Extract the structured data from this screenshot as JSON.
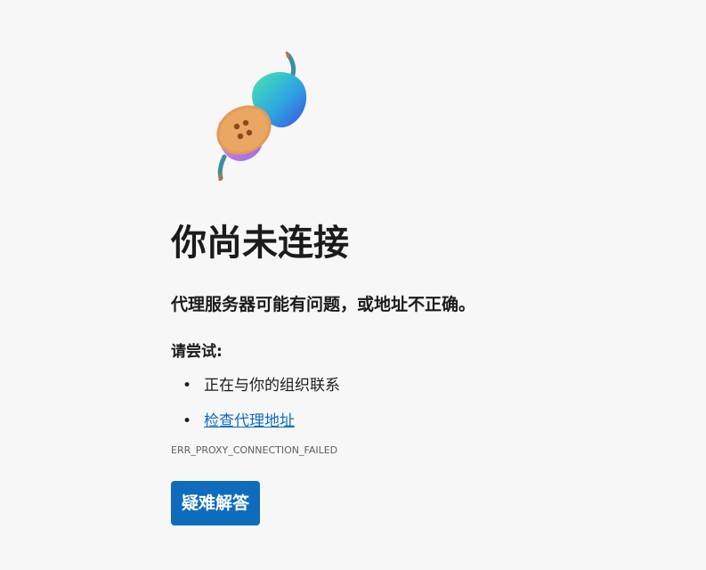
{
  "illustration": {
    "icon": "disconnected-plug-icon",
    "colors": {
      "plug_gradient_start": "#3ddcb0",
      "plug_gradient_end": "#2f5fe8",
      "socket_cookie": "#e39a55",
      "socket_purple": "#c27be8",
      "cable": "#3a8ea0",
      "cable_end": "#c2703a"
    }
  },
  "error": {
    "title": "你尚未连接",
    "subtitle": "代理服务器可能有问题，或地址不正确。",
    "try_label": "请尝试:",
    "suggestions": [
      {
        "bullet": "•",
        "text": "正在与你的组织联系"
      },
      {
        "bullet": "•",
        "text": "检查代理地址"
      }
    ],
    "code": "ERR_PROXY_CONNECTION_FAILED"
  },
  "actions": {
    "troubleshoot_label": "疑难解答"
  },
  "colors": {
    "background": "#f7f7f7",
    "accent": "#0f6cbd",
    "text": "#1b1b1b",
    "muted": "#5e5e5e"
  }
}
